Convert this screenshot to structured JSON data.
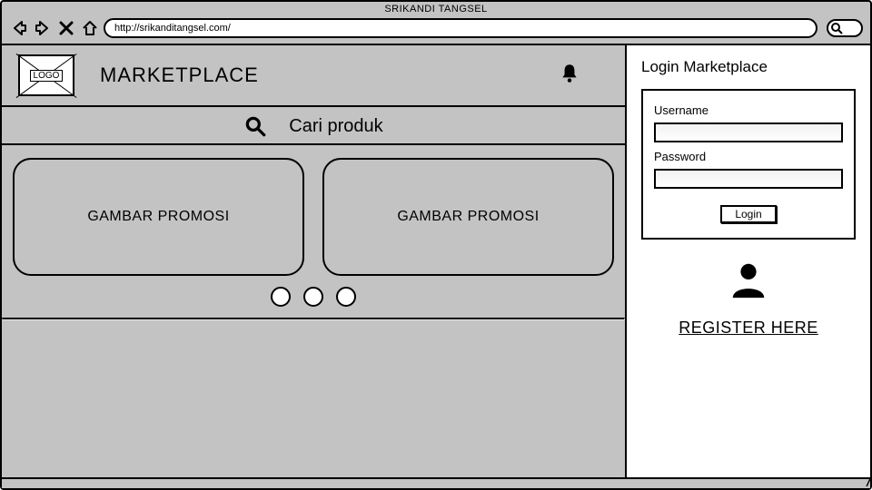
{
  "browser": {
    "title": "SRIKANDI TANGSEL",
    "url": "http://srikanditangsel.com/"
  },
  "header": {
    "logo_text": "LOGO",
    "brand": "MARKETPLACE"
  },
  "search": {
    "placeholder": "Cari produk"
  },
  "promos": [
    {
      "label": "GAMBAR PROMOSI"
    },
    {
      "label": "GAMBAR PROMOSI"
    }
  ],
  "login": {
    "title": "Login Marketplace",
    "username_label": "Username",
    "password_label": "Password",
    "button": "Login",
    "register": "REGISTER HERE"
  }
}
